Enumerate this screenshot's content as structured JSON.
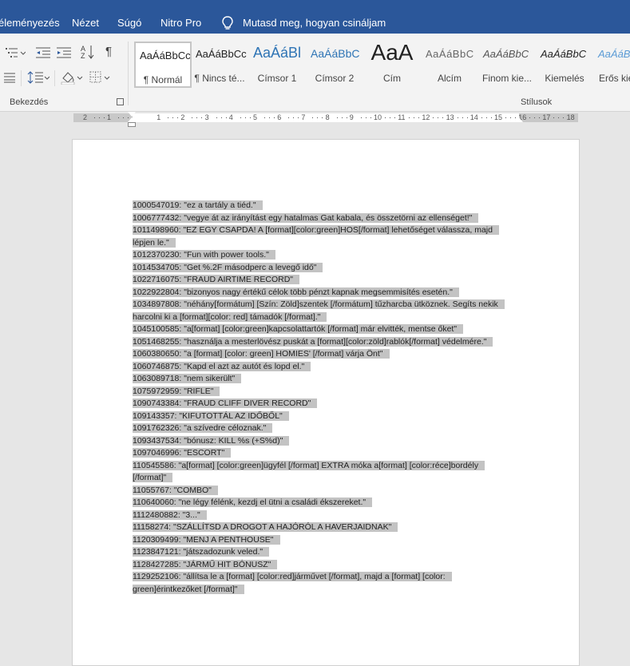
{
  "menubar": {
    "items": [
      "éleményezés",
      "Nézet",
      "Súgó",
      "Nitro Pro"
    ],
    "tell_me": "Mutasd meg, hogyan csináljam"
  },
  "ribbon": {
    "paragraph_group_label": "Bekezdés",
    "styles_group_label": "Stílusok",
    "sort_label": "A↓Z",
    "pilcrow": "¶",
    "styles": [
      {
        "preview": "AaÁáBbCc",
        "name": "¶ Normál"
      },
      {
        "preview": "AaÁáBbCc",
        "name": "¶ Nincs té..."
      },
      {
        "preview": "AaÁáBl",
        "name": "Címsor 1"
      },
      {
        "preview": "AaÁáBbC",
        "name": "Címsor 2"
      },
      {
        "preview": "AaA",
        "name": "Cím"
      },
      {
        "preview": "AaÁáBbC",
        "name": "Alcím"
      },
      {
        "preview": "AaÁáBbC",
        "name": "Finom kie..."
      },
      {
        "preview": "AaÁáBbC",
        "name": "Kiemelés"
      },
      {
        "preview": "AaÁáB",
        "name": "Erős kie"
      }
    ]
  },
  "ruler": {
    "labels": [
      "2",
      "1",
      "1",
      "2",
      "3",
      "4",
      "5",
      "6",
      "7",
      "8",
      "9",
      "10",
      "11",
      "12",
      "13",
      "14",
      "15",
      "16",
      "17",
      "18"
    ]
  },
  "document": {
    "lines": [
      "1000547019: \"ez a tartály a tiéd.\"",
      "1006777432: \"vegye át az irányítást egy hatalmas Gat kabala, és összetörni az ellenséget!\"",
      "1011498960: \"EZ EGY CSAPDA! A [format][color:green]HOS[/format] lehetőséget válassza, majd",
      "lépjen le.\"",
      "1012370230: \"Fun with power tools.\"",
      "1014534705: \"Get %.2F másodperc a levegő idő\"",
      "1022716075: \"FRAUD AIRTIME RECORD\"",
      "1022922804: \"bizonyos nagy értékű célok több pénzt kapnak megsemmisítés esetén.\"",
      "1034897808: \"néhány[formátum] [Szín: Zöld]szentek [/formátum] tűzharcba ütköznek.  Segíts nekik",
      "harcolni ki a [format][color: red] támadók [/format].\"",
      "1045100585: \"a[format] [color:green]kapcsolattartók [/format] már elvitték, mentse őket\"",
      "1051468255: \"használja a mesterlövész puskát a [format][color:zöld]rablók[/format] védelmére.\"",
      "1060380650: \"a [format] [color: green] HOMIES' [/format] várja Önt\"",
      "1060746875: \"Kapd el azt az autót és lopd el.\"",
      "1063089718: \"nem sikerült\"",
      "1075972959: \"RIFLE\"",
      "1090743384: \"FRAUD CLIFF DIVER RECORD\"",
      "109143357: \"KIFUTOTTÁL AZ IDŐBŐL\"",
      "1091762326: \"a szívedre céloznak.\"",
      "1093437534: \"bónusz: KILL %s (+S%d)\"",
      "1097046996: \"ESCORT\"",
      "110545586: \"a[format] [color:green]ügyfél [/format] EXTRA móka a[format] [color:réce]bordély",
      "[/format]\"",
      "11055767: \"COMBO\"",
      "110640060: \"ne légy félénk, kezdj el ütni a családi ékszereket.\"",
      "1112480882: \"3...\"",
      "11158274: \"SZÁLLÍTSD A DROGOT A HAJÓRÓL A HAVERJAIDNAK\"",
      "1120309499: \"MENJ A PENTHOUSE\"",
      "1123847121: \"játszadozunk veled.\"",
      "1128427285: \"JÁRMŰ HIT BÓNUSZ\"",
      "1129252106: \"állítsa le a [format] [color:red]járművet [/format], majd a [format] [color:",
      "green]érintkezőket [/format]\""
    ]
  }
}
